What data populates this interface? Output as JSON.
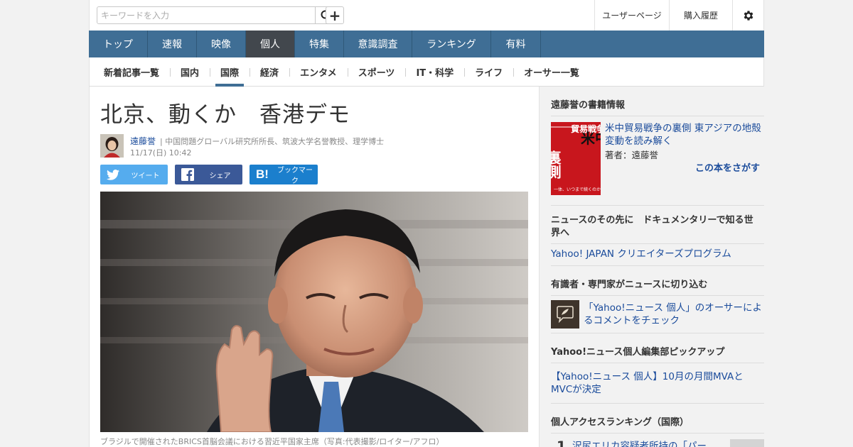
{
  "search": {
    "placeholder": "キーワードを入力"
  },
  "header": {
    "user_page": "ユーザーページ",
    "history": "購入履歴"
  },
  "global_nav": [
    {
      "label": "トップ",
      "active": false
    },
    {
      "label": "速報",
      "active": false
    },
    {
      "label": "映像",
      "active": false
    },
    {
      "label": "個人",
      "active": true
    },
    {
      "label": "特集",
      "active": false
    },
    {
      "label": "意識調査",
      "active": false
    },
    {
      "label": "ランキング",
      "active": false
    },
    {
      "label": "有料",
      "active": false
    }
  ],
  "sub_nav": [
    {
      "label": "新着記事一覧",
      "active": false
    },
    {
      "label": "国内",
      "active": false
    },
    {
      "label": "国際",
      "active": true
    },
    {
      "label": "経済",
      "active": false
    },
    {
      "label": "エンタメ",
      "active": false
    },
    {
      "label": "スポーツ",
      "active": false
    },
    {
      "label": "IT・科学",
      "active": false
    },
    {
      "label": "ライフ",
      "active": false
    },
    {
      "label": "オーサー一覧",
      "active": false
    }
  ],
  "article": {
    "title": "北京、動くか　香港デモ",
    "author_name": "遠藤誉",
    "author_title": "| 中国問題グローバル研究所所長、筑波大学名誉教授、理学博士",
    "date": "11/17(日) 10:42",
    "share": {
      "tweet": "ツイート",
      "facebook": "シェア",
      "hatena": "ブックマーク"
    },
    "caption": "ブラジルで開催されたBRICS首脳会議における習近平国家主席（写真:代表撮影/ロイター/アフロ）"
  },
  "sidebar": {
    "book_heading": "遠藤誉の書籍情報",
    "book_title": "米中貿易戦争の裏側 東アジアの地殻変動を読み解く",
    "book_author": "著者：遠藤誉",
    "book_search": "この本をさがす",
    "book_cover_text": {
      "top": "米中",
      "side": "裏側",
      "middle": "貿易戦争の",
      "bottom": "一体、いつまで続くのか？"
    },
    "docu_heading": "ニュースのその先に　ドキュメンタリーで知る世界へ",
    "docu_link": "Yahoo! JAPAN クリエイターズプログラム",
    "expert_heading": "有識者・専門家がニュースに切り込む",
    "expert_link": "「Yahoo!ニュース 個人」のオーサーによるコメントをチェック",
    "pickup_heading": "Yahoo!ニュース個人編集部ピックアップ",
    "pickup_link": "【Yahoo!ニュース 個人】10月の月間MVAとMVCが決定",
    "ranking_heading": "個人アクセスランキング（国際）",
    "ranking_first_num": "1",
    "ranking_first_title": "沢尻エリカ容疑者所持の「パー"
  },
  "colors": {
    "nav_bg": "#3f6e95",
    "nav_active": "#42474d",
    "link": "#1a4b9b",
    "twitter": "#55acee",
    "facebook": "#3b5998",
    "hatena": "#1b7fcd"
  },
  "icons": [
    "search-icon",
    "plus-icon",
    "gear-icon",
    "twitter-icon",
    "facebook-icon",
    "hatena-icon",
    "comment-pen-icon"
  ]
}
